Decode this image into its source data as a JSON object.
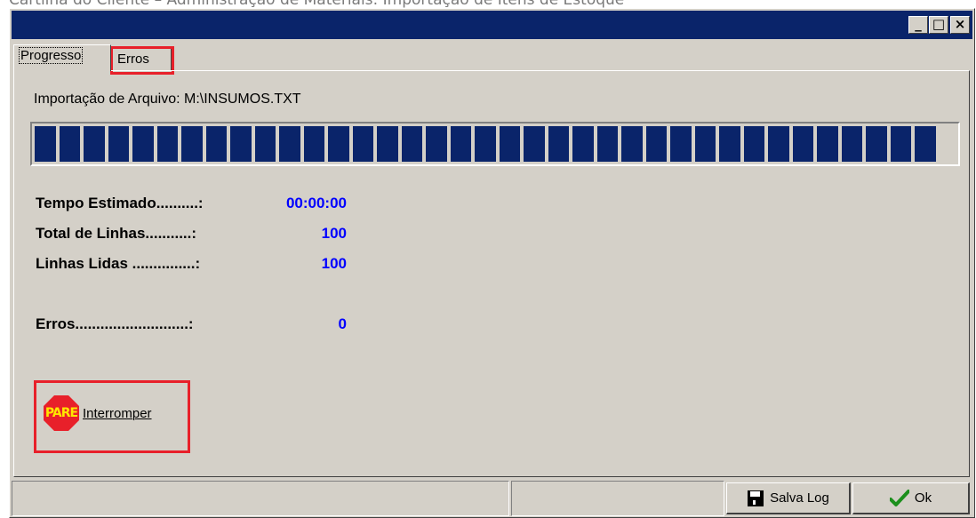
{
  "caption": "Cartilha do Cliente – Administração de Materiais: Importação de Itens de Estoque",
  "window": {
    "minimize": "_",
    "maximize": "□",
    "close": "×"
  },
  "tabs": [
    {
      "label": "Progresso",
      "active": true
    },
    {
      "label": "Erros",
      "active": false
    }
  ],
  "file": {
    "label": "Importação de Arquivo: M:\\INSUMOS.TXT"
  },
  "progress": {
    "percent": 100,
    "block_color": "#0a246a"
  },
  "stats": [
    {
      "label": "Tempo Estimado..........:",
      "value": "00:00:00"
    },
    {
      "label": "Total de Linhas...........:",
      "value": "100"
    },
    {
      "label": "Linhas Lidas ...............:",
      "value": "100"
    },
    {
      "label": "Erros...........................:",
      "value": "0"
    }
  ],
  "stop": {
    "icon_text": "PARE",
    "label": "Interromper"
  },
  "buttons": {
    "save_log": "Salva Log",
    "ok": "Ok"
  },
  "colors": {
    "highlight": "#e8202a",
    "value_blue": "#0000ff",
    "titlebar": "#0a246a"
  }
}
